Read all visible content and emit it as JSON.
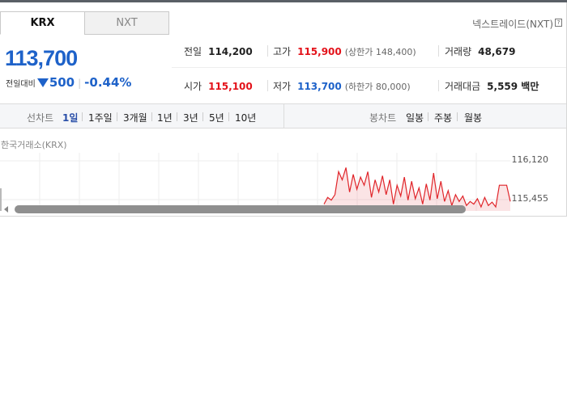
{
  "market_tabs": [
    {
      "label": "KRX"
    },
    {
      "label": "NXT"
    }
  ],
  "nxt_link": "넥스트레이드(NXT)",
  "nxt_help_icon": "?",
  "price": "113,700",
  "change": {
    "label": "전일대비",
    "amount": "500",
    "percent": "-0.44%",
    "direction": "down"
  },
  "stats": {
    "prev_close": {
      "label": "전일",
      "value": "114,200"
    },
    "high": {
      "label": "고가",
      "value": "115,900",
      "upper_limit_text": "(상한가 148,400)"
    },
    "volume": {
      "label": "거래량",
      "value": "48,679"
    },
    "open": {
      "label": "시가",
      "value": "115,100"
    },
    "low": {
      "label": "저가",
      "value": "113,700",
      "lower_limit_text": "(하한가 80,000)"
    },
    "amount": {
      "label": "거래대금",
      "value": "5,559 백만"
    }
  },
  "chart_bar": {
    "line_label": "선차트",
    "periods": [
      "1일",
      "1주일",
      "3개월",
      "1년",
      "3년",
      "5년",
      "10년"
    ],
    "active_period": "1일",
    "candle_label": "봉차트",
    "candles": [
      "일봉",
      "주봉",
      "월봉"
    ]
  },
  "chart_source": "한국거래소(KRX)",
  "colors": {
    "price_down": "#1e62c9",
    "price_up": "#e3121a",
    "line": "#e0252a"
  },
  "chart_data": {
    "type": "area",
    "title": "",
    "y_ticks": [
      "116,120",
      "115,455"
    ],
    "ylim": [
      115320,
      116180
    ],
    "series": [
      {
        "values": [
          115420,
          115520,
          115480,
          115560,
          115900,
          115780,
          115960,
          115600,
          115860,
          115640,
          115820,
          115700,
          115900,
          115520,
          115780,
          115600,
          115840,
          115560,
          115780,
          115420,
          115700,
          115540,
          115820,
          115480,
          115760,
          115500,
          115660,
          115420,
          115720,
          115480,
          115880,
          115500,
          115760,
          115460,
          115620,
          115400,
          115560,
          115460,
          115540,
          115400,
          115460,
          115420,
          115500,
          115380,
          115520,
          115400,
          115450,
          115380,
          115700,
          115700,
          115700,
          115460
        ]
      }
    ]
  }
}
